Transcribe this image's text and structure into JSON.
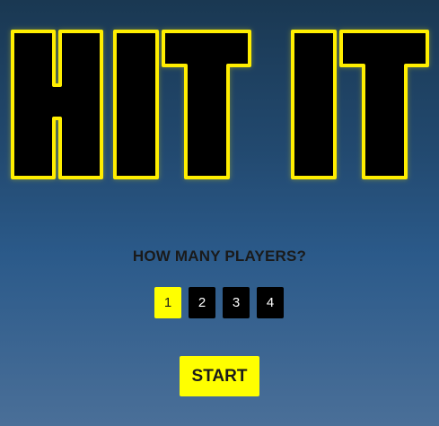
{
  "title": {
    "text": "HIT IT"
  },
  "setup": {
    "question": "HOW MANY PLAYERS?",
    "player_options": [
      "1",
      "2",
      "3",
      "4"
    ],
    "selected_players": "1"
  },
  "actions": {
    "start_label": "START"
  },
  "colors": {
    "accent": "#ffff00",
    "title_fill": "#000000",
    "title_outline": "#ffee00",
    "button_dark": "#000000",
    "background_top": "#1a3852",
    "background_bottom": "#4a6f98"
  }
}
